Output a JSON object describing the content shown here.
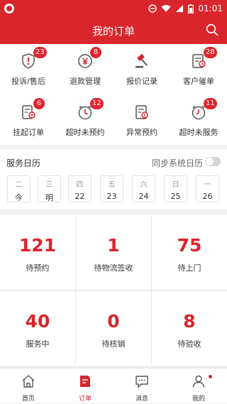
{
  "status_bar": {
    "time": "01:01"
  },
  "header": {
    "title": "我的订单"
  },
  "shortcuts": [
    {
      "label": "投诉/售后",
      "badge": "23",
      "icon": "complaint-icon"
    },
    {
      "label": "退款管理",
      "badge": "8",
      "icon": "refund-icon"
    },
    {
      "label": "报价记录",
      "badge": "",
      "icon": "quote-hammer-icon"
    },
    {
      "label": "客户催单",
      "badge": "28",
      "icon": "customer-urge-icon"
    },
    {
      "label": "挂起订单",
      "badge": "6",
      "icon": "suspend-order-icon"
    },
    {
      "label": "超时未预约",
      "badge": "12",
      "icon": "timeout-appointment-icon"
    },
    {
      "label": "异常预约",
      "badge": "",
      "icon": "abnormal-appointment-icon"
    },
    {
      "label": "超时未服务",
      "badge": "11",
      "icon": "timeout-service-icon"
    }
  ],
  "calendar": {
    "title": "服务日历",
    "sync_label": "同步系统日历",
    "days": [
      {
        "weekday": "二",
        "date": "今"
      },
      {
        "weekday": "三",
        "date": "明"
      },
      {
        "weekday": "四",
        "date": "22"
      },
      {
        "weekday": "五",
        "date": "23"
      },
      {
        "weekday": "六",
        "date": "24"
      },
      {
        "weekday": "日",
        "date": "25"
      },
      {
        "weekday": "一",
        "date": "26"
      }
    ]
  },
  "stats": [
    {
      "value": "121",
      "label": "待预约"
    },
    {
      "value": "1",
      "label": "待物流签收"
    },
    {
      "value": "75",
      "label": "待上门"
    },
    {
      "value": "40",
      "label": "服务中"
    },
    {
      "value": "0",
      "label": "待核销"
    },
    {
      "value": "8",
      "label": "待验收"
    }
  ],
  "tabbar": [
    {
      "label": "首页",
      "icon": "home-icon"
    },
    {
      "label": "订单",
      "icon": "order-icon"
    },
    {
      "label": "消息",
      "icon": "message-icon"
    },
    {
      "label": "我的",
      "icon": "profile-icon"
    }
  ],
  "colors": {
    "brand_red": "#d9252c",
    "badge_red": "#e0242c"
  }
}
